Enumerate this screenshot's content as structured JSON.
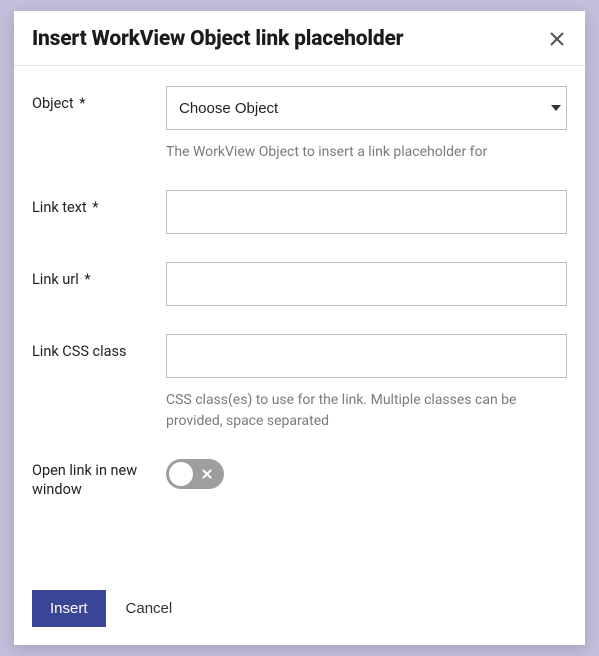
{
  "modal": {
    "title": "Insert WorkView Object link placeholder"
  },
  "fields": {
    "object": {
      "label": "Object",
      "required_mark": "*",
      "selected": "Choose Object",
      "help": "The WorkView Object to insert a link placeholder for"
    },
    "link_text": {
      "label": "Link text",
      "required_mark": "*",
      "value": ""
    },
    "link_url": {
      "label": "Link url",
      "required_mark": "*",
      "value": ""
    },
    "link_css": {
      "label": "Link CSS class",
      "value": "",
      "help": "CSS class(es) to use for the link. Multiple classes can be provided, space separated"
    },
    "open_new": {
      "label": "Open link in new window",
      "state": "off"
    }
  },
  "footer": {
    "primary": "Insert",
    "cancel": "Cancel"
  }
}
